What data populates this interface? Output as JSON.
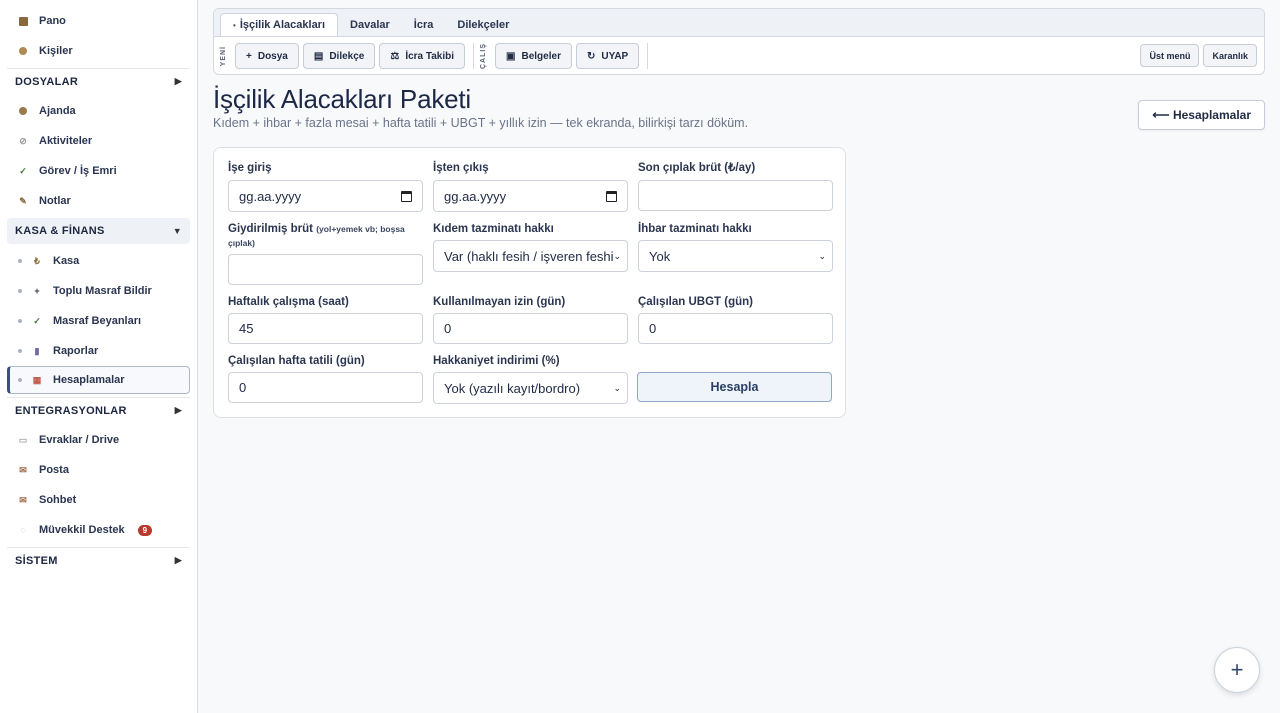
{
  "sidebar": {
    "top_items": [
      {
        "label": "Pano",
        "icon": "dashboard-icon"
      },
      {
        "label": "Kişiler",
        "icon": "people-icon"
      }
    ],
    "dosyalar": {
      "title": "DOSYALAR",
      "items": [
        {
          "label": "Ajanda",
          "icon": "calendar-icon"
        },
        {
          "label": "Aktiviteler",
          "icon": "activity-icon"
        },
        {
          "label": "Görev / İş Emri",
          "icon": "check-icon"
        },
        {
          "label": "Notlar",
          "icon": "pencil-icon"
        }
      ]
    },
    "kasa": {
      "title": "KASA & FİNANS",
      "items": [
        {
          "label": "Kasa",
          "icon": "lira-icon",
          "glyph": "₺"
        },
        {
          "label": "Toplu Masraf Bildir",
          "icon": "plus-icon",
          "glyph": "+"
        },
        {
          "label": "Masraf Beyanları",
          "icon": "check-icon",
          "glyph": "✓"
        },
        {
          "label": "Raporlar",
          "icon": "chart-icon",
          "glyph": "▮"
        },
        {
          "label": "Hesaplamalar",
          "icon": "calculator-icon",
          "glyph": "▦"
        }
      ]
    },
    "entegrasyonlar": {
      "title": "ENTEGRASYONLAR",
      "items": [
        {
          "label": "Evraklar / Drive",
          "icon": "folder-icon"
        },
        {
          "label": "Posta",
          "icon": "mail-icon"
        },
        {
          "label": "Sohbet",
          "icon": "chat-icon"
        },
        {
          "label": "Müvekkil Destek",
          "icon": "support-icon",
          "badge": "9"
        }
      ]
    },
    "sistem": {
      "title": "SİSTEM"
    }
  },
  "toolbar": {
    "tabs": [
      "İşçilik Alacakları",
      "Davalar",
      "İcra",
      "Dilekçeler"
    ],
    "group1_label": "YENİ",
    "group1_buttons": [
      "Dosya",
      "Dilekçe",
      "İcra Takibi"
    ],
    "group2_label": "ÇALIŞ",
    "group2_buttons": [
      "Belgeler",
      "UYAP"
    ],
    "right_buttons": [
      "Üst menü",
      "Karanlık"
    ]
  },
  "page": {
    "title": "İşçilik Alacakları Paketi",
    "subtitle": "Kıdem + ihbar + fazla mesai + hafta tatili + UBGT + yıllık izin — tek ekranda, bilirkişi tarzı döküm.",
    "back_button": "⟵ Hesaplamalar"
  },
  "form": {
    "ise_giris": {
      "label": "İşe giriş",
      "placeholder": "gg.aa.yyyy"
    },
    "isten_cikis": {
      "label": "İşten çıkış",
      "placeholder": "gg.aa.yyyy"
    },
    "son_brut": {
      "label": "Son çıplak brüt (₺/ay)",
      "value": ""
    },
    "giydirilmis": {
      "label": "Giydirilmiş brüt",
      "note": "(yol+yemek vb; boşsa çıplak)",
      "value": ""
    },
    "kidem_hakki": {
      "label": "Kıdem tazminatı hakkı",
      "value": "Var (haklı fesih / işveren feshi vb.)"
    },
    "ihbar_hakki": {
      "label": "İhbar tazminatı hakkı",
      "value": "Yok"
    },
    "haftalik": {
      "label": "Haftalık çalışma (saat)",
      "value": "45"
    },
    "izin": {
      "label": "Kullanılmayan izin (gün)",
      "value": "0"
    },
    "ubgt": {
      "label": "Çalışılan UBGT (gün)",
      "value": "0"
    },
    "hafta_tatili": {
      "label": "Çalışılan hafta tatili (gün)",
      "value": "0"
    },
    "hakkaniyet": {
      "label": "Hakkaniyet indirimi (%)",
      "value": "Yok (yazılı kayıt/bordro)"
    },
    "submit": "Hesapla"
  },
  "fab": "+"
}
